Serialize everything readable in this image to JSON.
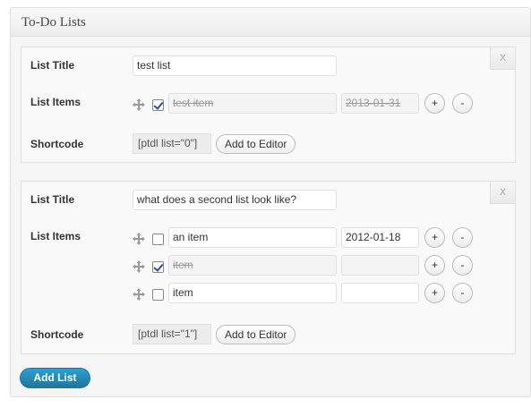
{
  "panel": {
    "title": "To-Do Lists"
  },
  "labels": {
    "list_title": "List Title",
    "list_items": "List Items",
    "shortcode": "Shortcode",
    "add_to_editor": "Add to Editor",
    "remove": "X",
    "plus": "+",
    "minus": "-"
  },
  "lists": [
    {
      "title": "test list",
      "shortcode": "[ptdl list=\"0\"]",
      "items": [
        {
          "checked": true,
          "text": "test item",
          "date": "2013-01-31"
        }
      ]
    },
    {
      "title": "what does a second list look like?",
      "shortcode": "[ptdl list=\"1\"]",
      "items": [
        {
          "checked": false,
          "text": "an item",
          "date": "2012-01-18"
        },
        {
          "checked": true,
          "text": "item",
          "date": ""
        },
        {
          "checked": false,
          "text": "item",
          "date": ""
        }
      ]
    }
  ],
  "footer": {
    "add_list_label": "Add List"
  },
  "icons": {
    "drag": "move-icon",
    "remove": "close-icon"
  },
  "colors": {
    "primary": "#21759b",
    "panel_bg": "#f5f5f5",
    "border": "#dfdfdf"
  }
}
